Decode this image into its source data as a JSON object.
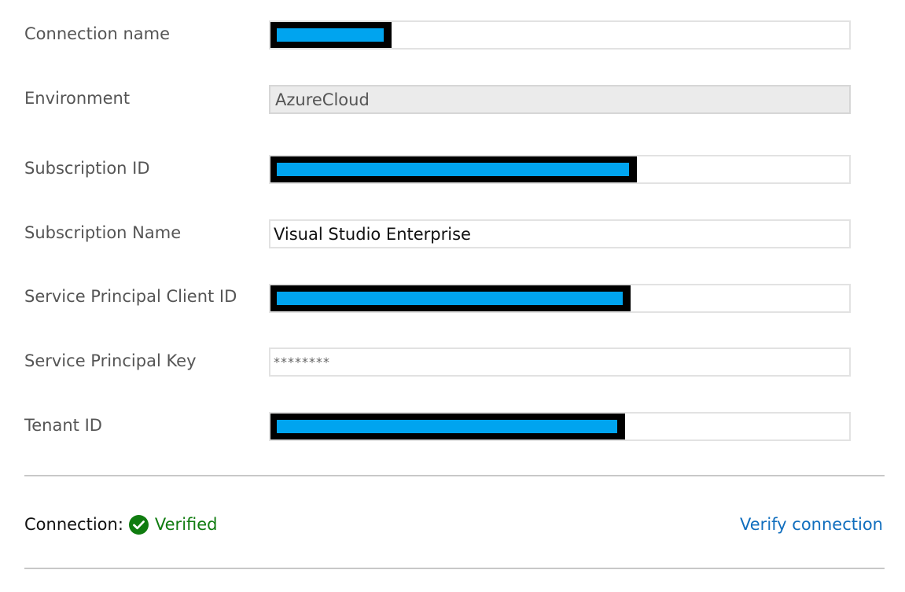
{
  "form": {
    "fields": [
      {
        "label": "Connection name",
        "value": "",
        "redacted": true
      },
      {
        "label": "Environment",
        "value": "AzureCloud",
        "readonly": true
      },
      {
        "label": "Subscription ID",
        "value": "",
        "redacted": true
      },
      {
        "label": "Subscription Name",
        "value": "Visual Studio Enterprise"
      },
      {
        "label": "Service Principal Client ID",
        "value": "",
        "redacted": true
      },
      {
        "label": "Service Principal Key",
        "value": "********",
        "masked": true
      },
      {
        "label": "Tenant ID",
        "value": "",
        "redacted": true
      }
    ]
  },
  "connection": {
    "label": "Connection:",
    "status": "Verified",
    "status_icon": "check-circle-icon",
    "status_color": "#107c10",
    "verify_link": "Verify connection",
    "link_color": "#106ebe"
  },
  "colors": {
    "redaction_outer": "#000000",
    "redaction_inner": "#00a4ef"
  }
}
